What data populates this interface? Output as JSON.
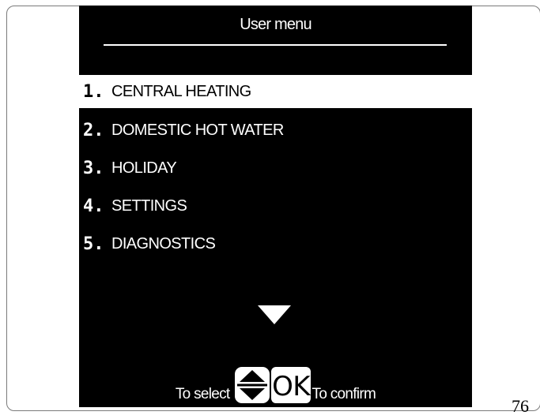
{
  "title": "User menu",
  "menu": {
    "items": [
      {
        "num": "1.",
        "label": "CENTRAL HEATING",
        "selected": true
      },
      {
        "num": "2.",
        "label": "DOMESTIC HOT WATER",
        "selected": false
      },
      {
        "num": "3.",
        "label": "HOLIDAY",
        "selected": false
      },
      {
        "num": "4.",
        "label": "SETTINGS",
        "selected": false
      },
      {
        "num": "5.",
        "label": "DIAGNOSTICS",
        "selected": false
      }
    ]
  },
  "footer": {
    "select_label": "To select",
    "ok_label": "OK",
    "confirm_label": "To confirm"
  },
  "icons": {
    "more": "triangle-down-icon",
    "navigate": "up-down-keys-icon",
    "confirm": "ok-key-icon"
  },
  "colors": {
    "screen": "#000000",
    "text": "#ffffff",
    "selection": "#ffffff"
  },
  "page_number": "76"
}
